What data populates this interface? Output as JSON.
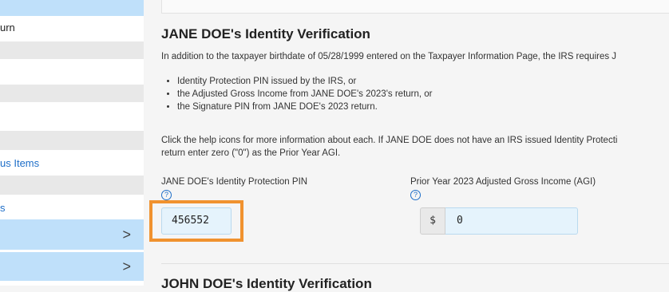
{
  "sidebar": {
    "items": [
      {
        "label": "",
        "style": "blue"
      },
      {
        "label": "urn",
        "style": "plain"
      },
      {
        "label": "",
        "style": "grey"
      },
      {
        "label": "",
        "style": "plain"
      },
      {
        "label": "",
        "style": "grey"
      },
      {
        "label": "",
        "style": "plain"
      },
      {
        "label": "",
        "style": "grey"
      },
      {
        "label": "us Items",
        "style": "link"
      },
      {
        "label": "",
        "style": "grey"
      },
      {
        "label": "s",
        "style": "link"
      },
      {
        "label": ">",
        "style": "blue-chevron"
      },
      {
        "label": ">",
        "style": "blue-chevron"
      }
    ]
  },
  "main": {
    "jane": {
      "title": "JANE DOE's Identity Verification",
      "intro": "In addition to the taxpayer birthdate of 05/28/1999 entered on the Taxpayer Information Page, the IRS requires J",
      "options": [
        "Identity Protection PIN issued by the IRS, or",
        "the Adjusted Gross Income from JANE DOE's 2023's return, or",
        "the Signature PIN from JANE DOE's 2023 return."
      ],
      "help_line1": "Click the help icons for more information about each. If JANE DOE does not have an IRS issued Identity Protecti",
      "help_line2": "return enter zero (\"0\") as the Prior Year AGI.",
      "pin_label": "JANE DOE's Identity Protection PIN",
      "pin_value": "456552",
      "agi_label": "Prior Year 2023 Adjusted Gross Income (AGI)",
      "agi_prefix": "$",
      "agi_value": "0",
      "help_icon": "?"
    },
    "john": {
      "title": "JOHN DOE's Identity Verification"
    }
  },
  "colors": {
    "sidebar_blue": "#bfe0fa",
    "link": "#1e6ec8",
    "highlight": "#f0922f",
    "input_bg": "#e5f3fc"
  }
}
